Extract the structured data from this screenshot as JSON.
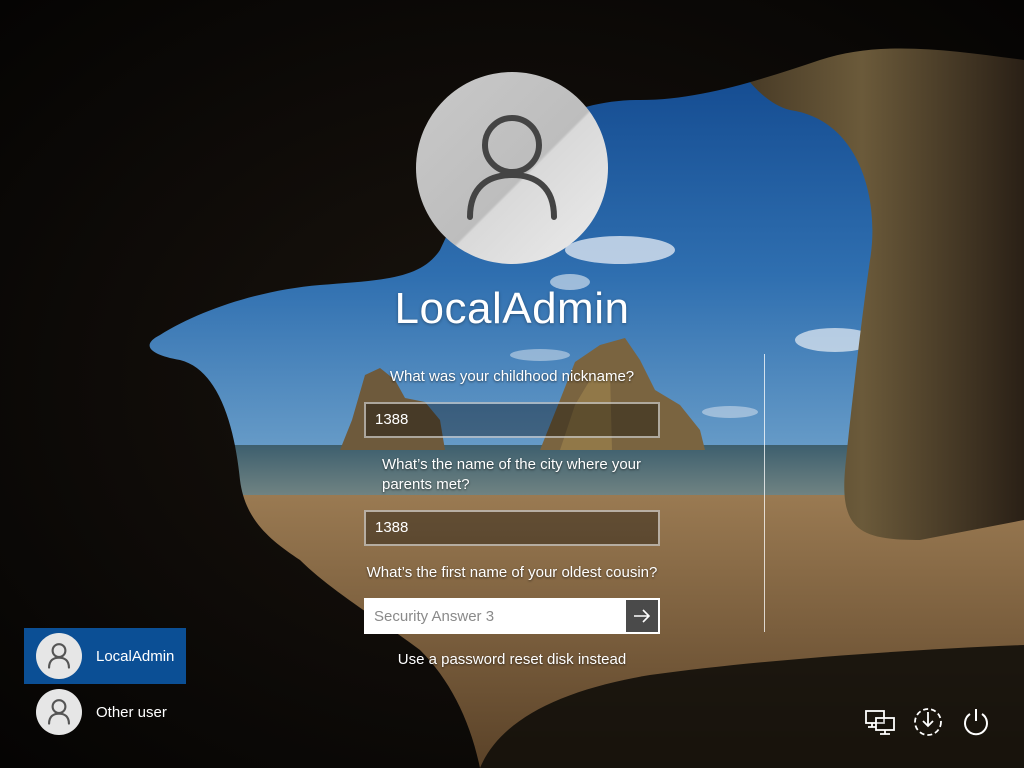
{
  "user": {
    "name": "LocalAdmin"
  },
  "security": {
    "q1": "What was your childhood nickname?",
    "a1": "1388",
    "q2_line1": "What’s the name of the city where your",
    "q2_line2": "parents met?",
    "a2": "1388",
    "q3": "What’s the first name of your oldest cousin?",
    "a3_placeholder": "Security Answer 3",
    "a3_value": ""
  },
  "reset_link": "Use a password reset disk instead",
  "user_list": [
    {
      "label": "LocalAdmin",
      "selected": true
    },
    {
      "label": "Other user",
      "selected": false
    }
  ],
  "system_icons": [
    "network-icon",
    "ease-of-access-icon",
    "power-icon"
  ],
  "colors": {
    "selected_tile": "#0b4f95",
    "submit_button": "#4a4a4a"
  }
}
